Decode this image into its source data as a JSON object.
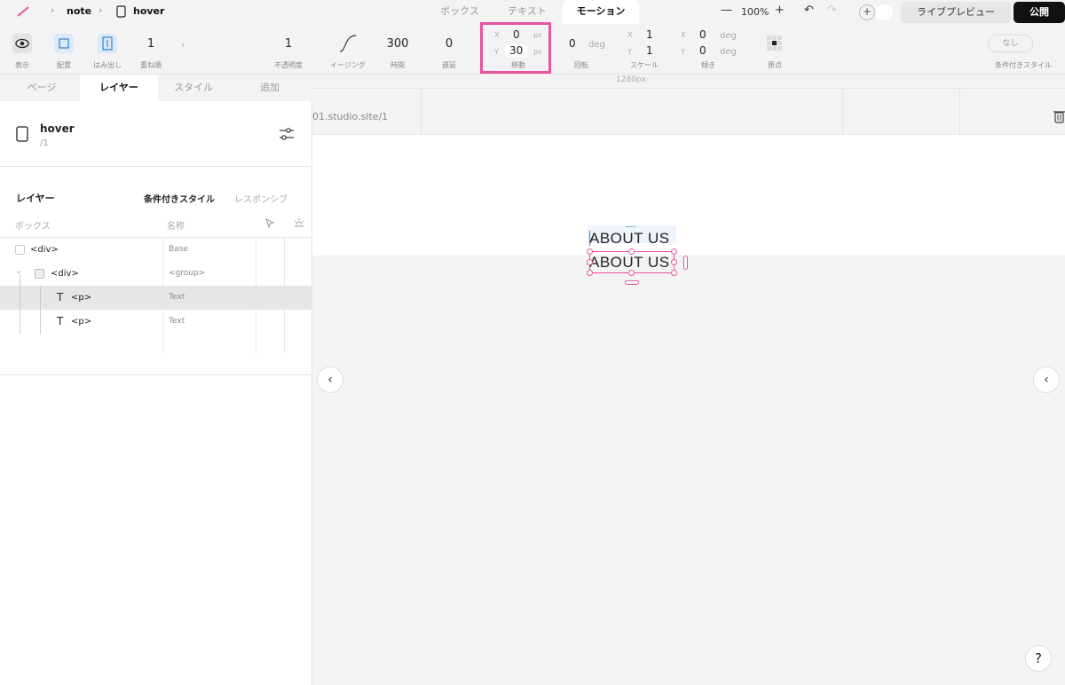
{
  "topbar": {
    "project": "note",
    "page": "hover",
    "tabs": [
      "ボックス",
      "テキスト",
      "モーション"
    ],
    "active_tab": "モーション",
    "zoom": "100%",
    "zoom_out": "—",
    "zoom_in": "+",
    "live_preview": "ライブプレビュー",
    "publish": "公開"
  },
  "toolbar": {
    "visibility_label": "表示",
    "align_label": "配置",
    "overflow_label": "はみ出し",
    "zindex_value": "1",
    "zindex_label": "重ね順",
    "opacity_value": "1",
    "opacity_label": "不透明度",
    "easing_label": "イージング",
    "duration_value": "300",
    "duration_label": "時間",
    "delay_value": "0",
    "delay_label": "遅延",
    "move": {
      "x_label": "X",
      "x_value": "0",
      "x_unit": "px",
      "y_label": "Y",
      "y_value": "30",
      "y_unit": "px",
      "label": "移動"
    },
    "rotate": {
      "value": "0",
      "unit": "deg",
      "label": "回転"
    },
    "scale": {
      "x_label": "X",
      "x_value": "1",
      "y_label": "Y",
      "y_value": "1",
      "label": "スケール"
    },
    "skew": {
      "x_label": "X",
      "x_value": "0",
      "x_unit": "deg",
      "y_label": "Y",
      "y_value": "0",
      "y_unit": "deg",
      "label": "傾き"
    },
    "origin_label": "原点",
    "conditional_value": "なし",
    "conditional_label": "条件付きスタイル"
  },
  "leftpanel": {
    "tabs": [
      "ページ",
      "レイヤー",
      "スタイル",
      "追加"
    ],
    "active_tab": "レイヤー",
    "page_title": "hover",
    "page_path": "/1",
    "layer_heading": "レイヤー",
    "layer_tab_conditional": "条件付きスタイル",
    "layer_tab_responsive": "レスポンシブ",
    "col_box": "ボックス",
    "col_name": "名称",
    "rows": [
      {
        "box": "<div>",
        "name": "Base"
      },
      {
        "box": "<div>",
        "name": "<group>"
      },
      {
        "box": "<p>",
        "name": "Text"
      },
      {
        "box": "<p>",
        "name": "Text"
      }
    ]
  },
  "canvas": {
    "ruler_label": "1280px",
    "url": "01.studio.site/1",
    "text_line1": "ABOUT US",
    "text_line2": "ABOUT US",
    "help": "?"
  },
  "colors": {
    "accent": "#e8539f",
    "selection": "#e8539f",
    "publish_bg": "#111111"
  }
}
